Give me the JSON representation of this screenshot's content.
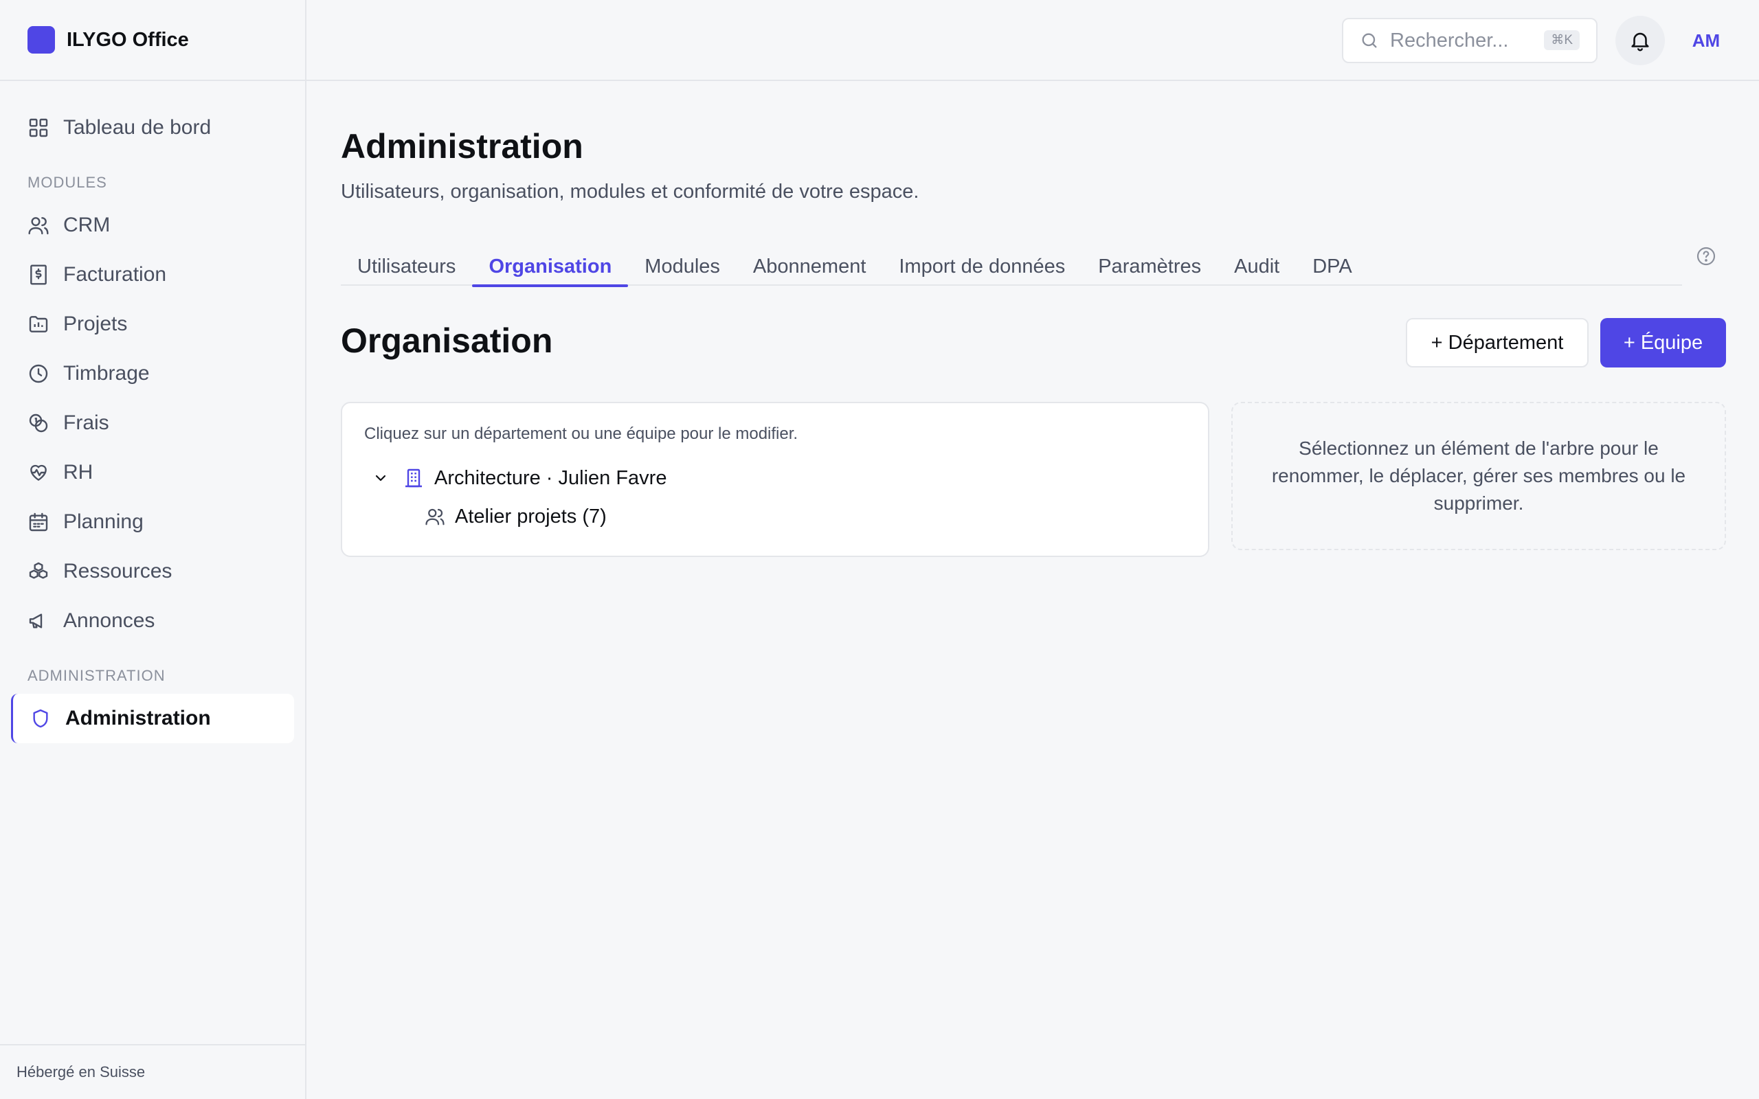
{
  "app": {
    "name": "ILYGO Office"
  },
  "sidebar": {
    "dashboard_label": "Tableau de bord",
    "modules_heading": "MODULES",
    "items": [
      {
        "label": "CRM",
        "icon": "users-icon"
      },
      {
        "label": "Facturation",
        "icon": "invoice-icon"
      },
      {
        "label": "Projets",
        "icon": "folder-icon"
      },
      {
        "label": "Timbrage",
        "icon": "clock-icon"
      },
      {
        "label": "Frais",
        "icon": "coins-icon"
      },
      {
        "label": "RH",
        "icon": "heart-pulse-icon"
      },
      {
        "label": "Planning",
        "icon": "calendar-icon"
      },
      {
        "label": "Ressources",
        "icon": "boxes-icon"
      },
      {
        "label": "Annonces",
        "icon": "megaphone-icon"
      }
    ],
    "admin_heading": "ADMINISTRATION",
    "admin_item": {
      "label": "Administration",
      "icon": "shield-icon"
    },
    "footer": "Hébergé en Suisse"
  },
  "topbar": {
    "search_placeholder": "Rechercher...",
    "shortcut": "⌘K",
    "avatar_initials": "AM"
  },
  "page": {
    "title": "Administration",
    "subtitle": "Utilisateurs, organisation, modules et conformité de votre espace."
  },
  "tabs": [
    {
      "label": "Utilisateurs",
      "active": false
    },
    {
      "label": "Organisation",
      "active": true
    },
    {
      "label": "Modules",
      "active": false
    },
    {
      "label": "Abonnement",
      "active": false
    },
    {
      "label": "Import de données",
      "active": false
    },
    {
      "label": "Paramètres",
      "active": false
    },
    {
      "label": "Audit",
      "active": false
    },
    {
      "label": "DPA",
      "active": false
    }
  ],
  "organisation": {
    "title": "Organisation",
    "add_department_label": "+ Département",
    "add_team_label": "+ Équipe",
    "hint": "Cliquez sur un département ou une équipe pour le modifier.",
    "department": "Architecture · Julien Favre",
    "team": "Atelier projets (7)",
    "empty_detail": "Sélectionnez un élément de l'arbre pour le renommer, le déplacer, gérer ses membres ou le supprimer."
  },
  "colors": {
    "accent": "#4f46e5",
    "text": "#0f1115",
    "muted": "#4a5060",
    "border": "#e4e6ea",
    "background": "#f6f7f9"
  }
}
